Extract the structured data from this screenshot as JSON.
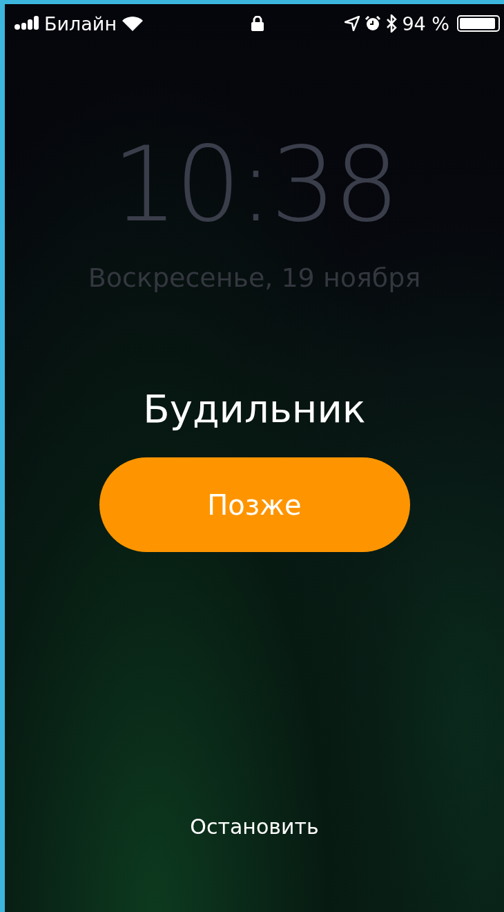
{
  "status_bar": {
    "carrier": "Билайн",
    "battery_percent": "94 %",
    "battery": {
      "level": 0.94
    }
  },
  "lock_screen": {
    "time": "10:38",
    "date": "Воскресенье, 19 ноября"
  },
  "alarm": {
    "title": "Будильник",
    "snooze_button": "Позже",
    "stop_button": "Остановить"
  }
}
